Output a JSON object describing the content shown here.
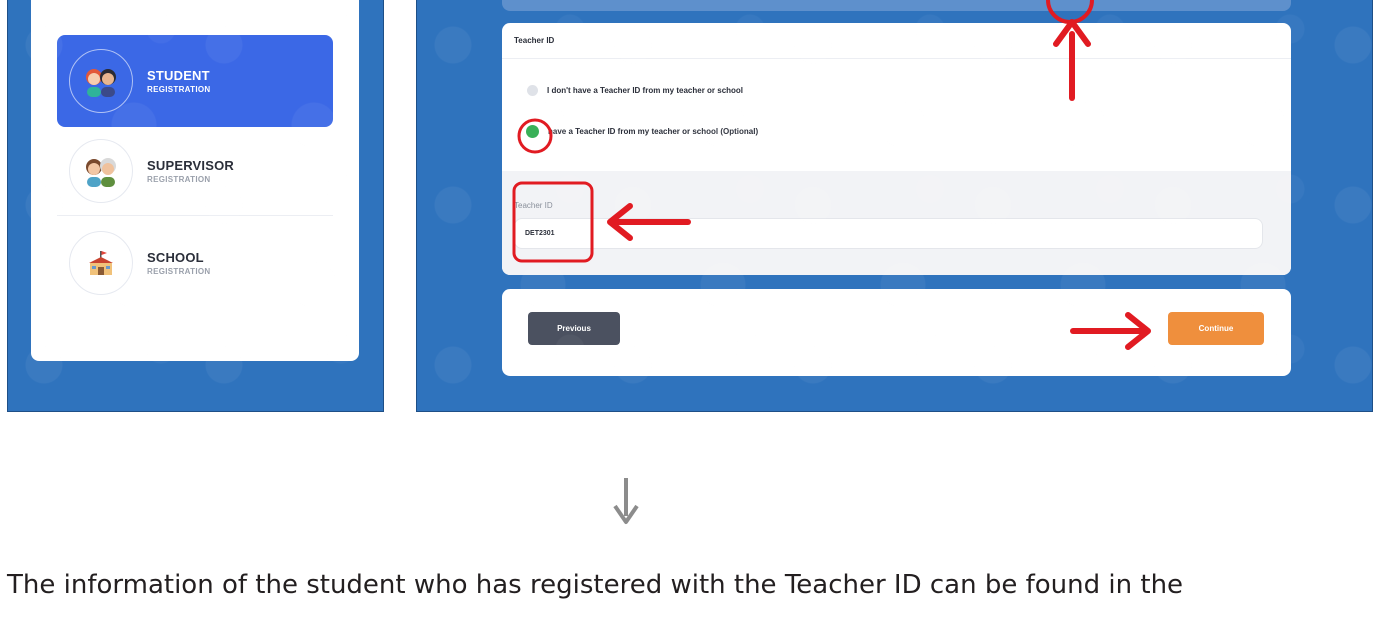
{
  "roles": [
    {
      "title": "STUDENT",
      "subtitle": "REGISTRATION",
      "active": true
    },
    {
      "title": "SUPERVISOR",
      "subtitle": "REGISTRATION",
      "active": false
    },
    {
      "title": "SCHOOL",
      "subtitle": "REGISTRATION",
      "active": false
    }
  ],
  "teacher_section": {
    "header": "Teacher ID",
    "option_no": "I don't have a Teacher ID from my teacher or school",
    "option_yes": "have a Teacher ID from my teacher or school (Optional)",
    "selected_option": "option_yes",
    "field_label": "Teacher ID",
    "field_value": "DET2301"
  },
  "navigation": {
    "previous_label": "Previous",
    "continue_label": "Continue"
  },
  "caption": "The information of the student who has registered with the Teacher ID can be found in the",
  "colors": {
    "panel_blue": "#2f73bd",
    "active_role": "#3b68e6",
    "continue_orange": "#ef8f3d",
    "previous_gray": "#4b5160",
    "radio_checked": "#2eac4f",
    "annotation_red": "#e11b22"
  },
  "icons": [
    "student-avatar-icon",
    "supervisor-avatar-icon",
    "school-building-icon",
    "down-arrow-icon",
    "annotation-arrow-icon"
  ]
}
